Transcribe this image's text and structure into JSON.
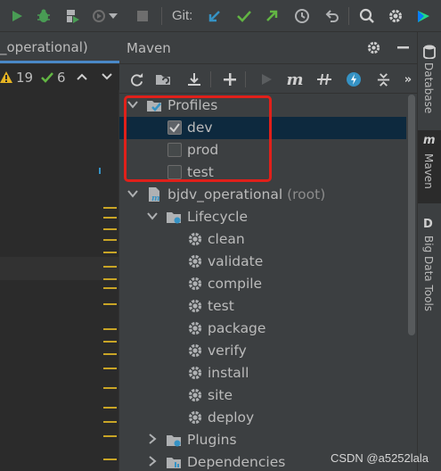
{
  "toolbar": {
    "git_label": "Git:"
  },
  "editor": {
    "tab_label": "_operational)",
    "warnings_count": "19",
    "weak_warnings_count": "6"
  },
  "maven": {
    "title": "Maven",
    "tree": {
      "profiles_label": "Profiles",
      "profiles": [
        {
          "label": "dev",
          "checked": true
        },
        {
          "label": "prod",
          "checked": false
        },
        {
          "label": "test",
          "checked": false
        }
      ],
      "project_label": "bjdv_operational",
      "project_suffix": "(root)",
      "lifecycle_label": "Lifecycle",
      "lifecycle_items": [
        "clean",
        "validate",
        "compile",
        "test",
        "package",
        "verify",
        "install",
        "site",
        "deploy"
      ],
      "plugins_label": "Plugins",
      "dependencies_label": "Dependencies"
    }
  },
  "sidebar": {
    "tabs": [
      "Database",
      "Maven",
      "Big Data Tools"
    ]
  },
  "watermark": "CSDN @a5252lala",
  "colors": {
    "selection": "#0d293e",
    "annotation_box": "#e0201a",
    "run_green": "#499c54",
    "git_blue": "#3592c4",
    "git_green": "#62b543"
  }
}
